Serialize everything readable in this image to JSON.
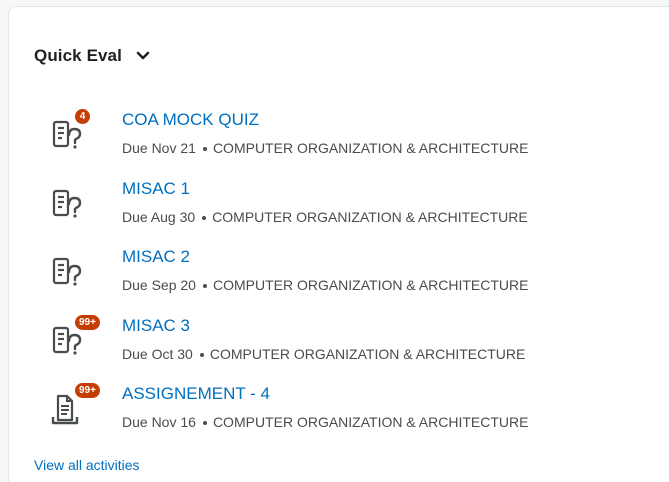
{
  "widget": {
    "title": "Quick Eval",
    "view_all_label": "View all activities"
  },
  "colors": {
    "link": "#006fbf",
    "badge": "#c33d04",
    "text": "#202122",
    "meta": "#494c4e"
  },
  "activities": [
    {
      "name": "COA MOCK QUIZ",
      "due": "Due Nov 21",
      "course": "COMPUTER ORGANIZATION & ARCHITECTURE",
      "badge": "4",
      "icon": "quiz-icon"
    },
    {
      "name": "MISAC 1",
      "due": "Due Aug 30",
      "course": "COMPUTER ORGANIZATION & ARCHITECTURE",
      "badge": "",
      "icon": "quiz-icon"
    },
    {
      "name": "MISAC 2",
      "due": "Due Sep 20",
      "course": "COMPUTER ORGANIZATION & ARCHITECTURE",
      "badge": "",
      "icon": "quiz-icon"
    },
    {
      "name": "MISAC 3",
      "due": "Due Oct 30",
      "course": "COMPUTER ORGANIZATION & ARCHITECTURE",
      "badge": "99+",
      "icon": "quiz-icon"
    },
    {
      "name": "ASSIGNEMENT - 4",
      "due": "Due Nov 16",
      "course": "COMPUTER ORGANIZATION & ARCHITECTURE",
      "badge": "99+",
      "icon": "assignment-icon"
    }
  ]
}
